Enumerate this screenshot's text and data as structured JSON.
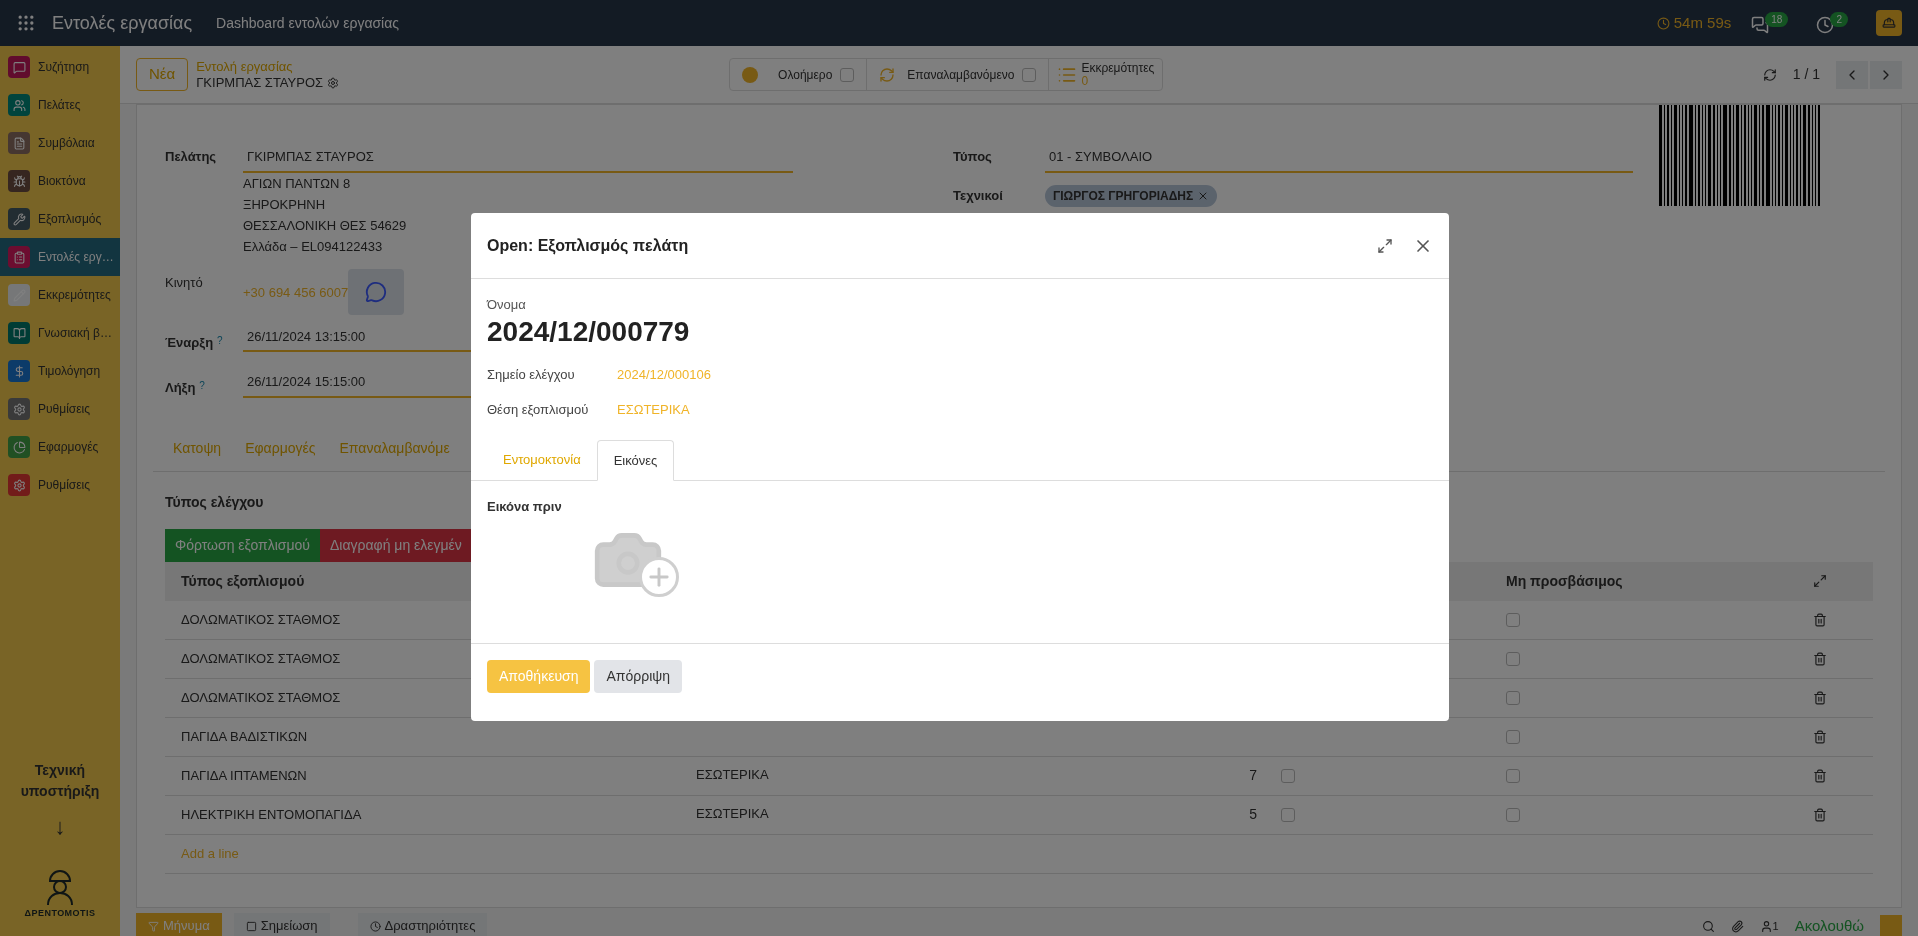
{
  "top_bar": {
    "app_title": "Εντολές εργασίας",
    "menu": "Dashboard εντολών εργασίας",
    "timer": "54m 59s",
    "messages_count": "18",
    "activities_count": "2"
  },
  "sidebar": {
    "items": [
      {
        "label": "Συζήτηση",
        "selected": false
      },
      {
        "label": "Πελάτες",
        "selected": false
      },
      {
        "label": "Συμβόλαια",
        "selected": false
      },
      {
        "label": "Βιοκτόνα",
        "selected": false
      },
      {
        "label": "Εξοπλισμός",
        "selected": false
      },
      {
        "label": "Εντολές εργ…",
        "selected": true
      },
      {
        "label": "Εκκρεμότητες",
        "selected": false
      },
      {
        "label": "Γνωσιακή β…",
        "selected": false
      },
      {
        "label": "Τιμολόγηση",
        "selected": false
      },
      {
        "label": "Ρυθμίσεις",
        "selected": false
      },
      {
        "label": "Εφαρμογές",
        "selected": false
      },
      {
        "label": "Ρυθμίσεις",
        "selected": false
      }
    ],
    "support_text": "Τεχνική υποστήριξη",
    "arrow": "↓",
    "logo_text": "ΔΡΕΝΤΟΜΟΤΙS"
  },
  "control_panel": {
    "new_button": "Νέα",
    "breadcrumb": "Εντολή εργασίας",
    "record_name": "ΓΚΙΡΜΠΑΣ ΣΤΑΥΡΟΣ",
    "toggles": [
      {
        "label": "Ολοήμερο",
        "checked": false
      },
      {
        "label": "Επαναλαμβανόμενο",
        "checked": false
      }
    ],
    "pending": {
      "label": "Εκκρεμότητες",
      "count": "0"
    },
    "pager": "1 / 1"
  },
  "form": {
    "customer": {
      "label": "Πελάτης",
      "value": "ΓΚΙΡΜΠΑΣ ΣΤΑΥΡΟΣ",
      "address": [
        "ΑΓΙΩΝ ΠΑΝΤΩΝ 8",
        "ΞΗΡΟΚΡΗΝΗ",
        "ΘΕΣΣΑΛΟΝΙΚΗ ΘΕΣ 54629",
        "Ελλάδα – EL094122433"
      ]
    },
    "mobile": {
      "label": "Κινητό",
      "value": "+30 694 456 6007"
    },
    "start": {
      "label": "Έναρξη",
      "help": "?",
      "value": "26/11/2024 13:15:00"
    },
    "end": {
      "label": "Λήξη",
      "help": "?",
      "value": "26/11/2024 15:15:00"
    },
    "type": {
      "label": "Τύπος",
      "value": "01 - ΣΥΜΒΟΛΑΙΟ"
    },
    "technicians": {
      "label": "Τεχνικοί",
      "tags": [
        "ΓΙΩΡΓΟΣ ΓΡΗΓΟΡΙΑΔΗΣ"
      ]
    },
    "tabs": [
      "Κατοψη",
      "Εφαρμογές",
      "Επαναλαμβανόμε"
    ],
    "section_title": "Τύπος ελέγχου",
    "buttons": [
      {
        "label": "Φόρτωση εξοπλισμού",
        "kind": "success"
      },
      {
        "label": "Διαγραφή μη ελεγμέν",
        "kind": "danger"
      }
    ],
    "table": {
      "columns": [
        "Τύπος εξοπλισμού",
        "Μη προσβάσιμος"
      ],
      "rows": [
        {
          "type": "ΔΟΛΩΜΑΤΙΚΟΣ ΣΤΑΘΜΟΣ",
          "inaccessible": false
        },
        {
          "type": "ΔΟΛΩΜΑΤΙΚΟΣ ΣΤΑΘΜΟΣ",
          "inaccessible": false
        },
        {
          "type": "ΔΟΛΩΜΑΤΙΚΟΣ ΣΤΑΘΜΟΣ",
          "inaccessible": false
        },
        {
          "type": "ΠΑΓΙΔΑ ΒΑΔΙΣΤΙΚΩΝ",
          "inaccessible": false
        },
        {
          "type": "ΠΑΓΙΔΑ ΙΠΤΑΜΕΝΩΝ",
          "position": "ΕΣΩΤΕΡΙΚΑ",
          "count": "7",
          "checked": false,
          "inaccessible": false
        },
        {
          "type": "ΗΛΕΚΤΡΙΚΗ ΕΝΤΟΜΟΠΑΓΙΔΑ",
          "position": "ΕΣΩΤΕΡΙΚΑ",
          "count": "5",
          "checked": false,
          "inaccessible": false
        }
      ],
      "add_line": "Add a line"
    }
  },
  "chatter": {
    "buttons": [
      "Μήνυμα",
      "Σημείωση",
      "Δραστηριότητες"
    ],
    "followers": "1",
    "follow": "Ακολουθώ"
  },
  "modal": {
    "title": "Open: Εξοπλισμός πελάτη",
    "name_label": "Όνομα",
    "name_value": "2024/12/000779",
    "fields": [
      {
        "label": "Σημείο ελέγχου",
        "value": "2024/12/000106"
      },
      {
        "label": "Θέση εξοπλισμού",
        "value": "ΕΣΩΤΕΡΙΚΑ"
      }
    ],
    "tabs": [
      {
        "label": "Εντομοκτονία",
        "selected": false
      },
      {
        "label": "Εικόνες",
        "selected": true
      }
    ],
    "image_label": "Εικόνα πριν",
    "buttons": [
      {
        "label": "Αποθήκευση",
        "kind": "primary"
      },
      {
        "label": "Απόρριψη",
        "kind": "secondary"
      }
    ]
  }
}
